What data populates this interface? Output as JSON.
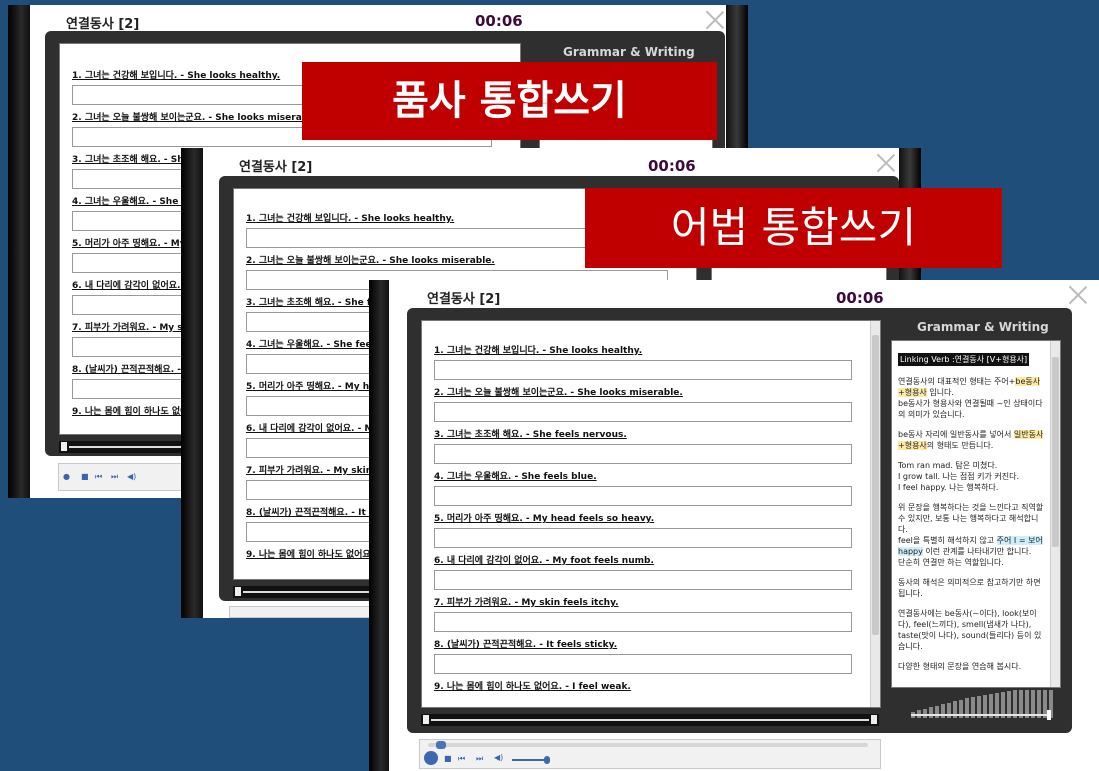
{
  "windows": [
    {
      "id": "w1",
      "title": "연결동사 [2]",
      "timer": "00:06"
    },
    {
      "id": "w2",
      "title": "연결동사 [2]",
      "timer": "00:06"
    },
    {
      "id": "w3",
      "title": "연결동사 [2]",
      "timer": "00:06"
    }
  ],
  "panel_title": "Grammar & Writing",
  "questions": [
    "1. 그녀는 건강해 보입니다. - She looks healthy.",
    "2. 그녀는 오늘 불쌍해 보이는군요. - She looks miserable.",
    "3. 그녀는 초조해 해요. - She feels nervous.",
    "4. 그녀는 우울해요. - She feels blue.",
    "5. 머리가 아주 띵해요. - My head feels so heavy.",
    "6. 내 다리에 감각이 없어요. - My foot feels numb.",
    "7. 피부가 가려워요. - My skin feels itchy.",
    "8. (날씨가) 끈적끈적해요. - It feels sticky.",
    "9. 나는 몸에 힘이 하나도 없어요. - I feel weak."
  ],
  "grammar": {
    "header": "Linking Verb :연결동사 [V+형용사]",
    "p1_a": "연결동사의 대표적인 형태는 주어+",
    "p1_hl": "be동사+형용사",
    "p1_b": " 입니다.",
    "p1_c": "be동사가 형용사와 연결될때 ~인 상태이다의 의미가 있습니다.",
    "p2_a": "be동사 자리에 일반동사를 넣어서 ",
    "p2_hl": "일반동사+형용사",
    "p2_b": "의 형태도 만듭니다.",
    "p3_1": "Tom ran mad. 탐은 미쳤다.",
    "p3_2": "I grow tall. 나는 점점 키가 커진다.",
    "p3_3": "I feel happy. 나는 행복하다.",
    "p4_a": "위 문장을 행복하다는 것을 느낀다고 직역할 수 있지만, 보통 나는 행복하다고 해석합니다.",
    "p4_b": "feel을 특별히 해석하지 않고 ",
    "p4_hl": "주어 I = 보어 happy",
    "p4_c": " 이런 관계를 나타내기만 합니다.",
    "p4_d": "단순히 연결만 하는 역할입니다.",
    "p5": "동사의 해석은 의미적으로 참고하기만 하면 됩니다.",
    "p6": "연결동사에는 be동사(~이다), look(보이다), feel(느끼다), smell(냄새가 나다), taste(맛이 나다), sound(들리다) 등이 있습니다.",
    "p7": "다양한 형태의 문장을 연습해 봅시다."
  },
  "banners": {
    "b1": "품사 통합쓰기",
    "b2": "어법 통합쓰기"
  },
  "colors": {
    "background": "#1e4e79",
    "banner": "#c00000",
    "timer": "#3a0a3a"
  }
}
